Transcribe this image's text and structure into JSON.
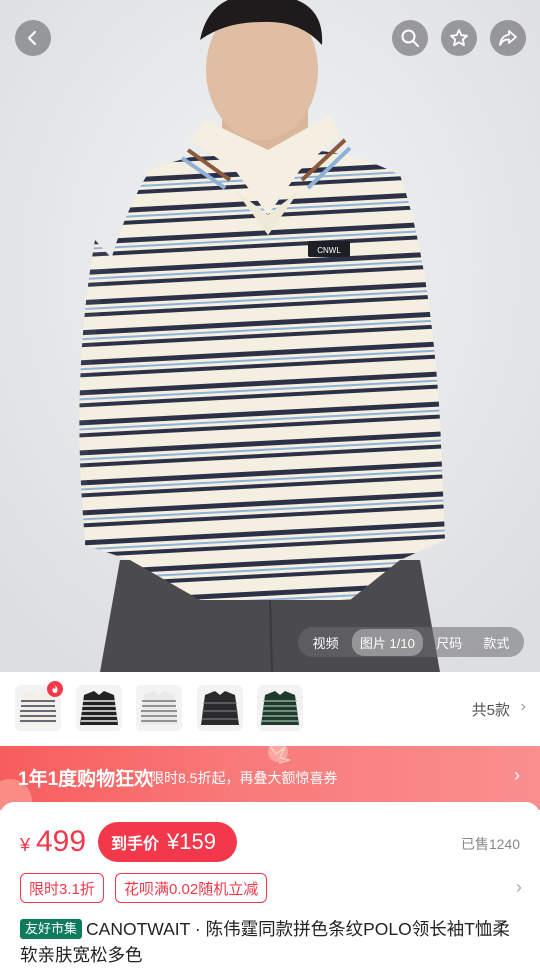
{
  "hero": {
    "shirt_badge": "CNWL",
    "media_tabs": [
      {
        "label": "视频",
        "active": false
      },
      {
        "label": "图片 1/10",
        "active": true
      },
      {
        "label": "尺码",
        "active": false
      },
      {
        "label": "款式",
        "active": false
      }
    ],
    "icons": [
      "back-arrow-icon",
      "search-icon",
      "star-icon",
      "share-icon"
    ]
  },
  "variants": {
    "count_label": "共5款",
    "thumbs": [
      {
        "name": "cream-navy-stripe",
        "hot": true
      },
      {
        "name": "black-white-stripe",
        "hot": false
      },
      {
        "name": "gray-stripe",
        "hot": false
      },
      {
        "name": "black-stripe",
        "hot": false
      },
      {
        "name": "green-stripe",
        "hot": false
      }
    ]
  },
  "promo": {
    "title": "1年1度购物狂欢",
    "subtitle": "限时8.5折起，再叠大额惊喜券"
  },
  "price": {
    "currency": "¥",
    "value": "499",
    "final_label": "到手价",
    "final_price": "¥159",
    "sold": "已售1240"
  },
  "tags": [
    "限时3.1折",
    "花呗满0.02随机立减"
  ],
  "product": {
    "brand_badge": "友好市集",
    "title": "CANOTWAIT · 陈伟霆同款拼色条纹POLO领长袖T恤柔软亲肤宽松多色"
  },
  "colors": {
    "accent": "#f2384a",
    "promo": "#f86b6b",
    "badge": "#0e7a5e"
  }
}
